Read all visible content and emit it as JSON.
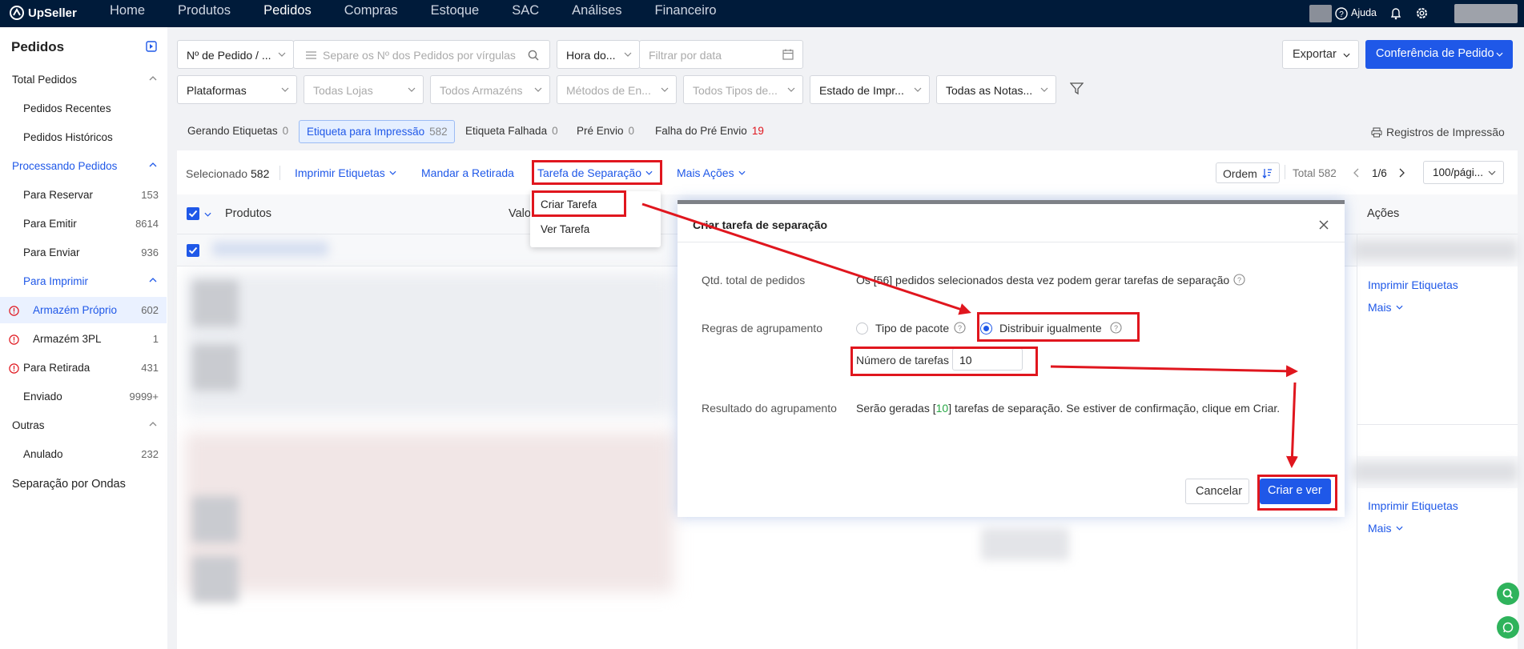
{
  "app": {
    "brand": "UpSeller"
  },
  "nav": {
    "items": [
      "Home",
      "Produtos",
      "Pedidos",
      "Compras",
      "Estoque",
      "SAC",
      "Análises",
      "Financeiro"
    ],
    "active_index": 2,
    "help": "Ajuda"
  },
  "sidebar": {
    "title": "Pedidos",
    "items": [
      {
        "label": "Total Pedidos",
        "count": "",
        "kind": "section"
      },
      {
        "label": "Pedidos Recentes",
        "count": "",
        "kind": "sub"
      },
      {
        "label": "Pedidos Históricos",
        "count": "",
        "kind": "sub"
      },
      {
        "label": "Processando Pedidos",
        "count": "",
        "kind": "section-blue"
      },
      {
        "label": "Para Reservar",
        "count": "153",
        "kind": "sub"
      },
      {
        "label": "Para Emitir",
        "count": "8614",
        "kind": "sub"
      },
      {
        "label": "Para Enviar",
        "count": "936",
        "kind": "sub"
      },
      {
        "label": "Para Imprimir",
        "count": "",
        "kind": "sub-blue"
      },
      {
        "label": "Armazém Próprio",
        "count": "602",
        "kind": "sub2-selected"
      },
      {
        "label": "Armazém 3PL",
        "count": "1",
        "kind": "sub2"
      },
      {
        "label": "Para Retirada",
        "count": "431",
        "kind": "sub-warn"
      },
      {
        "label": "Enviado",
        "count": "9999+",
        "kind": "sub"
      },
      {
        "label": "Outras",
        "count": "",
        "kind": "section"
      },
      {
        "label": "Anulado",
        "count": "232",
        "kind": "sub"
      },
      {
        "label": "Separação por Ondas",
        "count": "",
        "kind": "top"
      }
    ]
  },
  "filters": {
    "order_type": "Nº de Pedido / ...",
    "search_placeholder": "Separe os Nº dos Pedidos por vírgulas",
    "time_type": "Hora do...",
    "date_placeholder": "Filtrar por data",
    "platforms": "Plataformas",
    "stores": "Todas Lojas",
    "warehouses": "Todos Armazéns",
    "methods": "Métodos de En...",
    "types": "Todos Tipos de...",
    "print_state": "Estado de Impr...",
    "invoices": "Todas as Notas..."
  },
  "top_actions": {
    "export": "Exportar",
    "confirm": "Conferência de Pedido"
  },
  "tabs": [
    {
      "label": "Gerando Etiquetas",
      "count": "0"
    },
    {
      "label": "Etiqueta para Impressão",
      "count": "582"
    },
    {
      "label": "Etiqueta Falhada",
      "count": "0"
    },
    {
      "label": "Pré Envio",
      "count": "0"
    },
    {
      "label": "Falha do Pré Envio",
      "count": "19"
    }
  ],
  "print_records": "Registros de Impressão",
  "action_bar": {
    "selected_label": "Selecionado",
    "selected_count": "582",
    "print_labels": "Imprimir Etiquetas",
    "send_pickup": "Mandar a Retirada",
    "picking_task": "Tarefa de Separação",
    "more_actions": "Mais Ações",
    "order": "Ordem",
    "total": "Total 582",
    "page": "1/6",
    "per_page": "100/pági..."
  },
  "table": {
    "col_products": "Produtos",
    "col_value": "Valo",
    "col_actions": "Ações",
    "row_action_1": "Imprimir Etiquetas",
    "row_action_2": "Mais"
  },
  "dropdown": {
    "items": [
      "Criar Tarefa",
      "Ver Tarefa"
    ]
  },
  "modal": {
    "title": "Criar tarefa de separação",
    "total_label": "Qtd. total de pedidos",
    "total_prefix": "Os [",
    "total_count": "56",
    "total_suffix": "] pedidos selecionados desta vez podem gerar tarefas de separação",
    "rule_label": "Regras de agrupamento",
    "opt_package": "Tipo de pacote",
    "opt_equal": "Distribuir igualmente",
    "tasks_label": "Número de tarefas",
    "tasks_value": "10",
    "result_label": "Resultado do agrupamento",
    "result_prefix": "Serão geradas [",
    "result_count": "10",
    "result_suffix": "] tarefas de separação. Se estiver de confirmação, clique em Criar.",
    "cancel": "Cancelar",
    "create": "Criar e ver"
  },
  "colors": {
    "primary": "#1f58e8",
    "annotation": "#e0161e",
    "topbar": "#001b3a",
    "green": "#28a745"
  }
}
